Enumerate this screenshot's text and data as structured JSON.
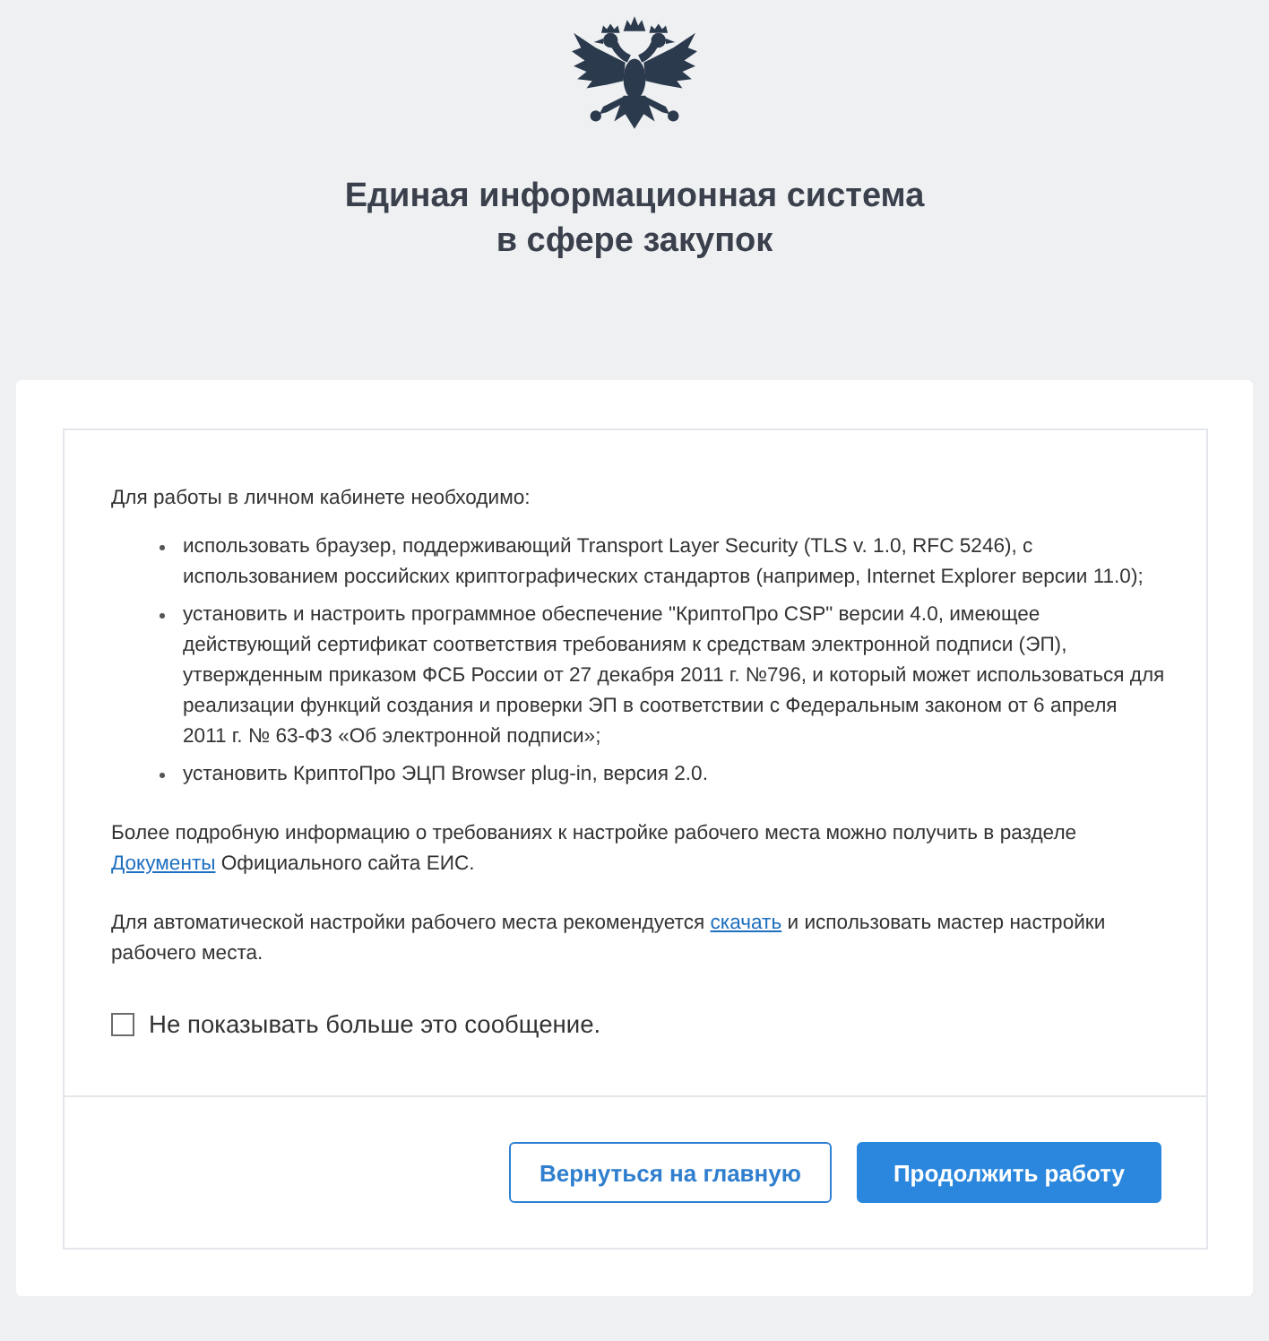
{
  "header": {
    "title_lines": [
      "Единая информационная система",
      "в сфере закупок"
    ]
  },
  "notice": {
    "intro": "Для работы в личном кабинете необходимо:",
    "requirements": [
      "использовать браузер, поддерживающий Transport Layer Security (TLS v. 1.0, RFC 5246), с использованием российских криптографических стандартов (например, Internet Explorer версии 11.0);",
      "установить и настроить программное обеспечение \"КриптоПро CSP\" версии 4.0, имеющее действующий сертификат соответствия требованиям к средствам электронной подписи (ЭП), утвержденным приказом ФСБ России от 27 декабря 2011 г. №796, и который может использоваться для реализации функций создания и проверки ЭП в соответствии с Федеральным законом от 6 апреля 2011 г. № 63-ФЗ «Об электронной подписи»;",
      "установить КриптоПро ЭЦП Browser plug-in, версия 2.0."
    ],
    "paragraphs": [
      [
        {
          "kind": "text",
          "text": "Более подробную информацию о требованиях к настройке рабочего места можно получить в разделе "
        },
        {
          "kind": "link",
          "text": "Документы"
        },
        {
          "kind": "text",
          "text": " Официального сайта ЕИС."
        }
      ],
      [
        {
          "kind": "text",
          "text": "Для автоматической настройки рабочего места рекомендуется "
        },
        {
          "kind": "link",
          "text": "скачать"
        },
        {
          "kind": "text",
          "text": " и использовать мастер настройки рабочего места."
        }
      ]
    ],
    "dont_show_again": {
      "label": "Не показывать больше это сообщение.",
      "checked": false
    }
  },
  "buttons": [
    {
      "label": "Вернуться на главную",
      "kind": "secondary"
    },
    {
      "label": "Продолжить работу",
      "kind": "primary"
    }
  ]
}
